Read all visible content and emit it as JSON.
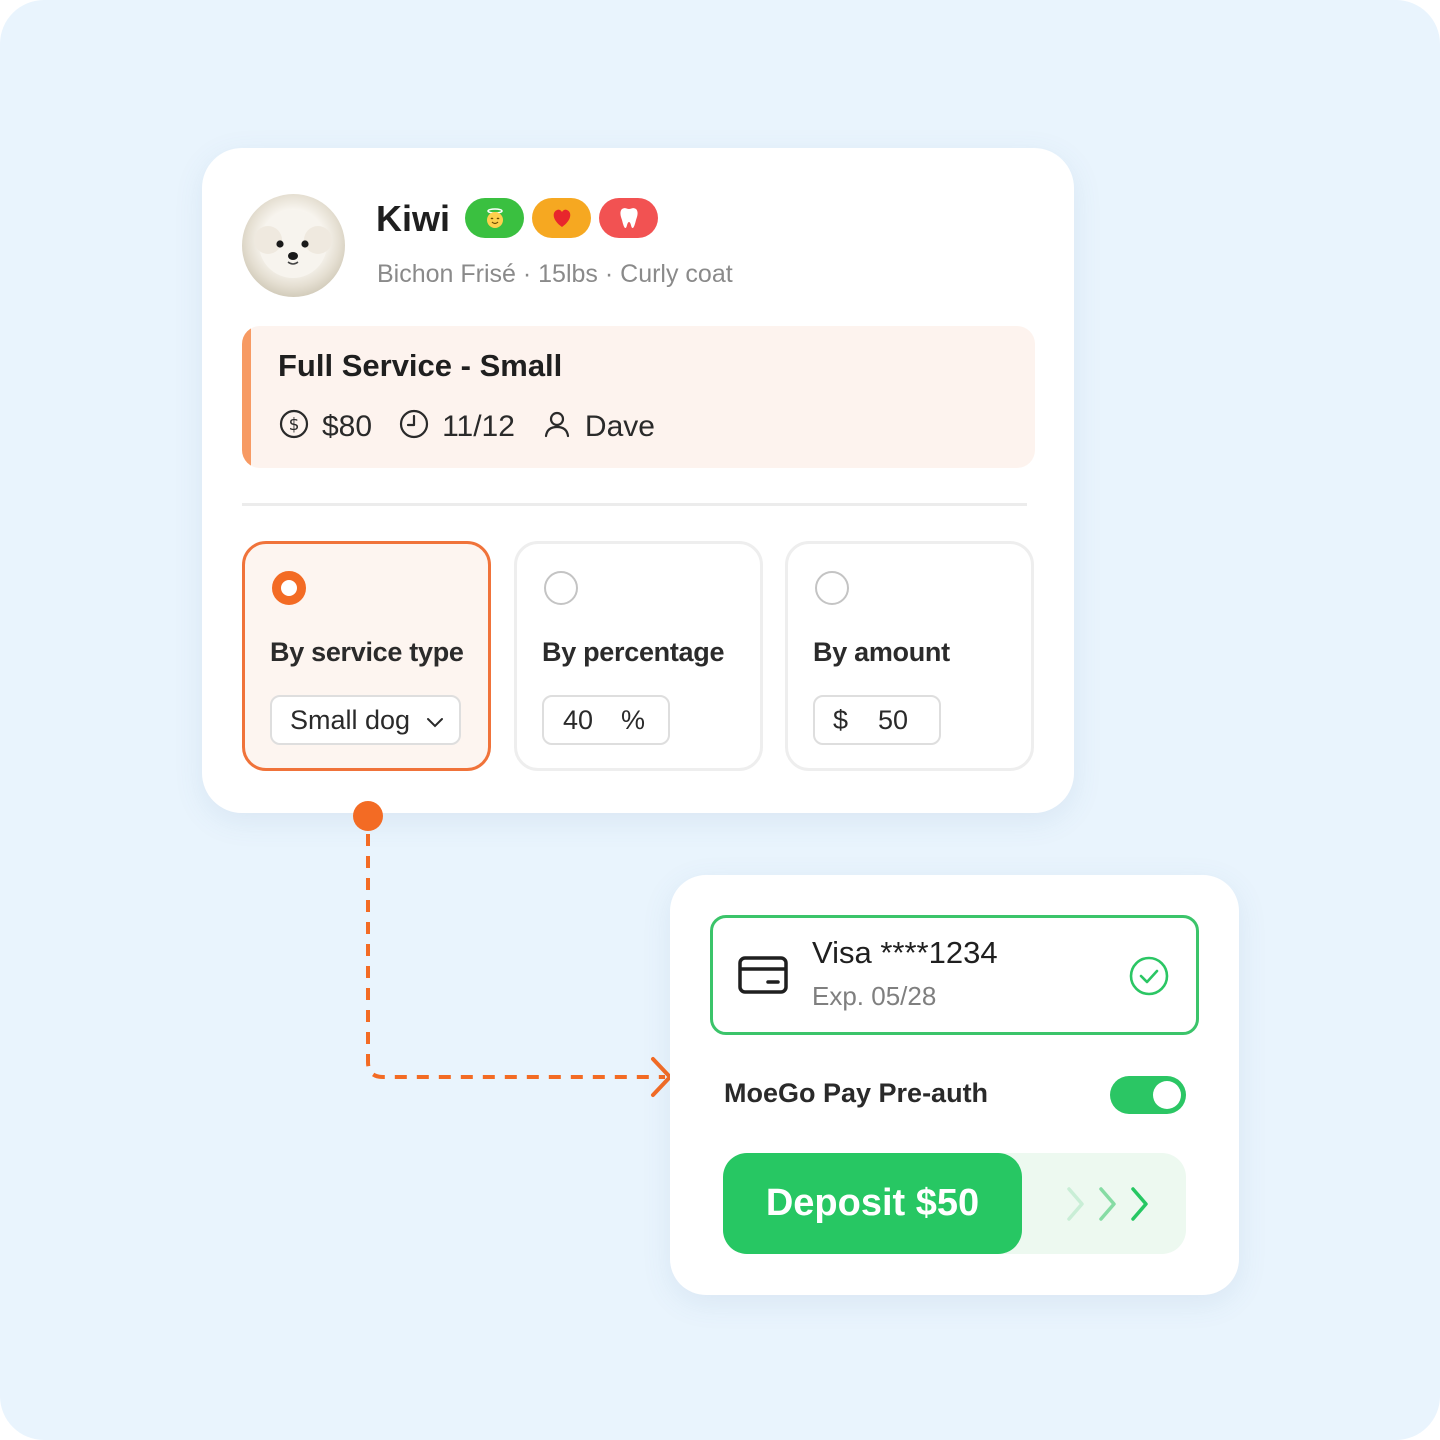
{
  "pet": {
    "name": "Kiwi",
    "meta": "Bichon Frisé · 15lbs · Curly coat",
    "badges": [
      {
        "icon": "angel-face-icon",
        "color": "#3ac040"
      },
      {
        "icon": "heart-icon",
        "color": "#f6a821"
      },
      {
        "icon": "tooth-icon",
        "color": "#f25252"
      }
    ]
  },
  "service": {
    "title": "Full Service - Small",
    "price": "$80",
    "date": "11/12",
    "staff": "Dave",
    "accent_color": "#f79a63"
  },
  "deposit_options": [
    {
      "label": "By service type",
      "selected": true,
      "value": "Small dog"
    },
    {
      "label": "By percentage",
      "selected": false,
      "value": "40",
      "unit": "%"
    },
    {
      "label": "By amount",
      "selected": false,
      "prefix": "$",
      "value": "50"
    }
  ],
  "payment": {
    "card_title": "Visa ****1234",
    "card_exp": "Exp. 05/28",
    "preauth_label": "MoeGo Pay Pre-auth",
    "preauth_enabled": true,
    "deposit_label": "Deposit $50"
  },
  "colors": {
    "background": "#e9f4fd",
    "brand_orange": "#f36b24",
    "success_green": "#27c763"
  }
}
